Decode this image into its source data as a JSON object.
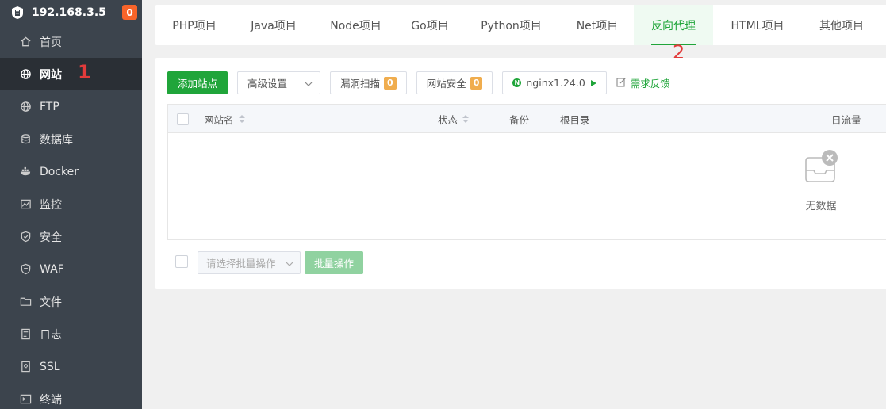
{
  "sidebar": {
    "host": "192.168.3.5",
    "badge": "0",
    "items": [
      {
        "label": "首页",
        "icon": "home-icon"
      },
      {
        "label": "网站",
        "icon": "globe-icon",
        "active": true
      },
      {
        "label": "FTP",
        "icon": "globe-icon"
      },
      {
        "label": "数据库",
        "icon": "database-icon"
      },
      {
        "label": "Docker",
        "icon": "docker-icon"
      },
      {
        "label": "监控",
        "icon": "chart-icon"
      },
      {
        "label": "安全",
        "icon": "shield-icon"
      },
      {
        "label": "WAF",
        "icon": "waf-shield-icon"
      },
      {
        "label": "文件",
        "icon": "folder-icon"
      },
      {
        "label": "日志",
        "icon": "log-icon"
      },
      {
        "label": "SSL",
        "icon": "ssl-icon"
      },
      {
        "label": "终端",
        "icon": "terminal-icon"
      }
    ]
  },
  "annotations": {
    "one": "1",
    "two": "2"
  },
  "tabs": [
    {
      "label": "PHP项目"
    },
    {
      "label": "Java项目"
    },
    {
      "label": "Node项目"
    },
    {
      "label": "Go项目"
    },
    {
      "label": "Python项目"
    },
    {
      "label": "Net项目"
    },
    {
      "label": "反向代理",
      "active": true
    },
    {
      "label": "HTML项目"
    },
    {
      "label": "其他项目"
    }
  ],
  "toolbar": {
    "add_site": "添加站点",
    "advanced": "高级设置",
    "vuln_scan": "漏洞扫描",
    "vuln_count": "0",
    "site_security": "网站安全",
    "security_count": "0",
    "nginx": "nginx1.24.0",
    "feedback": "需求反馈"
  },
  "table": {
    "columns": {
      "name": "网站名",
      "status": "状态",
      "backup": "备份",
      "root": "根目录",
      "traffic": "日流量"
    },
    "empty_text": "无数据"
  },
  "footer": {
    "batch_placeholder": "请选择批量操作",
    "batch_button": "批量操作"
  },
  "colors": {
    "accent": "#20a53a",
    "sidebar": "#3c444d",
    "badge": "#f7642a",
    "annotation": "#e23b3b"
  }
}
